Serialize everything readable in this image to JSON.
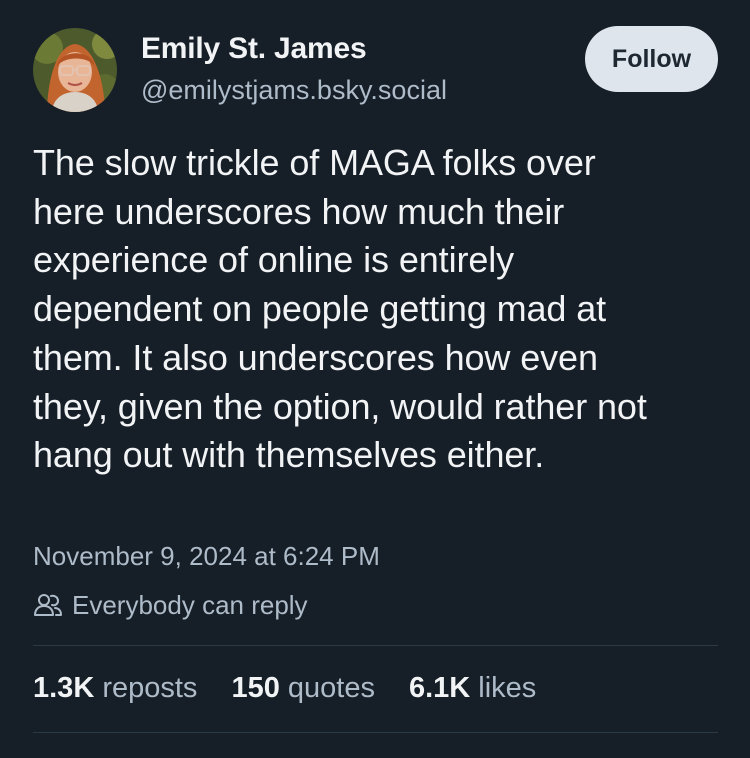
{
  "author": {
    "display_name": "Emily St. James",
    "handle": "@emilystjams.bsky.social"
  },
  "follow_label": "Follow",
  "post": {
    "lines": [
      "The slow trickle of MAGA folks over",
      "here underscores how much their",
      "experience of online is entirely",
      "dependent on people getting mad at",
      "them. It also underscores how even",
      "they, given the option, would rather not",
      "hang out with themselves either."
    ],
    "timestamp": "November 9, 2024 at 6:24 PM",
    "reply_setting": "Everybody can reply"
  },
  "stats": {
    "reposts_count": "1.3K",
    "reposts_label": "reposts",
    "quotes_count": "150",
    "quotes_label": "quotes",
    "likes_count": "6.1K",
    "likes_label": "likes"
  },
  "icons": {
    "avatar": "avatar-photo",
    "reply": "people-icon"
  },
  "colors": {
    "background": "#161e27",
    "primary_text": "#f1f3f5",
    "secondary_text": "#aebbc9",
    "follow_bg": "#dfe5ec",
    "divider": "#2b3846"
  }
}
